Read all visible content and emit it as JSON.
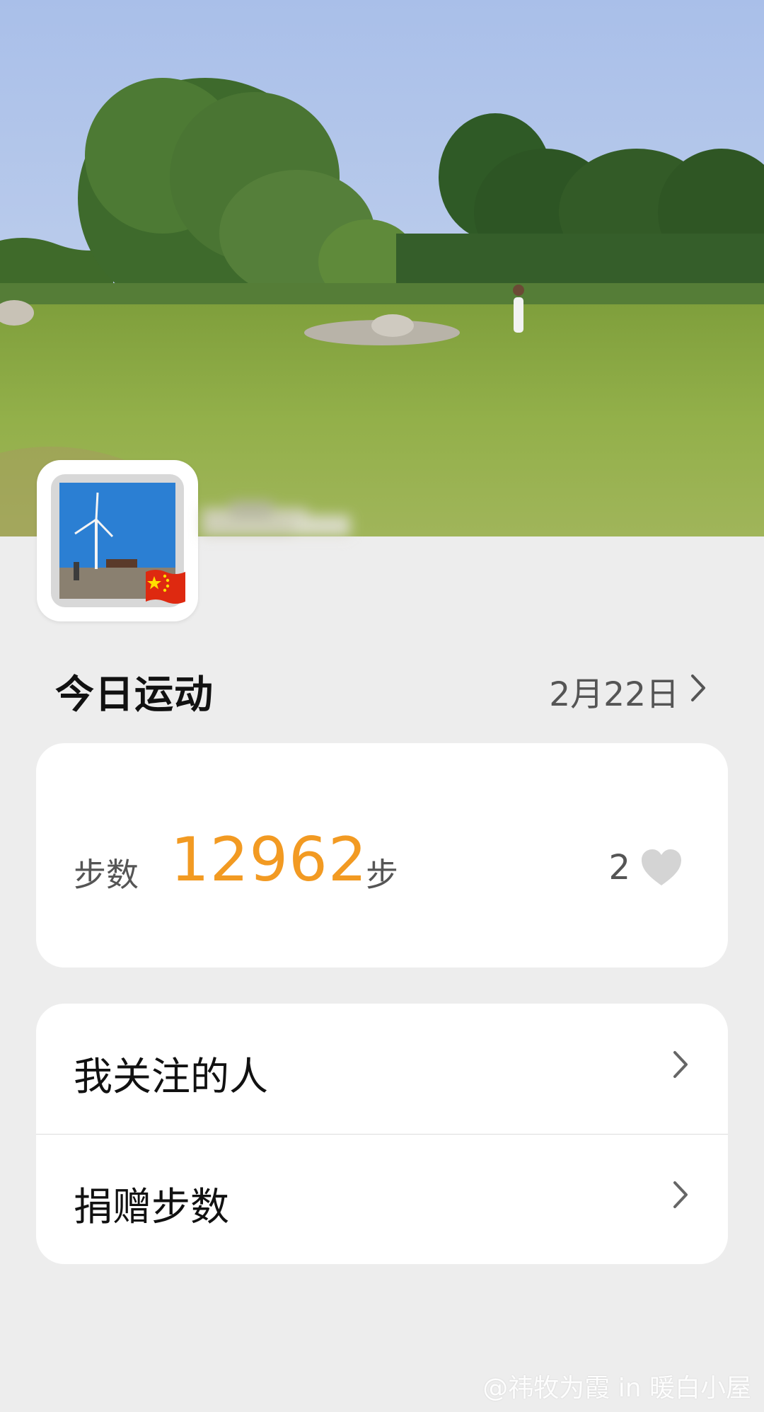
{
  "cover": {
    "type": "photo",
    "description_icon": "landscape-photo"
  },
  "profile": {
    "avatar_icon": "wind-turbine-photo",
    "badge_icon": "china-flag-icon"
  },
  "today": {
    "title": "今日运动",
    "date": "2月22日"
  },
  "steps": {
    "label": "步数",
    "value": "12962",
    "unit": "步",
    "likes": "2"
  },
  "list": [
    {
      "label": "我关注的人"
    },
    {
      "label": "捐赠步数"
    }
  ],
  "watermark": "@祎牧为霞 in 暖白小屋",
  "colors": {
    "accent": "#f29a22",
    "background": "#ededed"
  }
}
